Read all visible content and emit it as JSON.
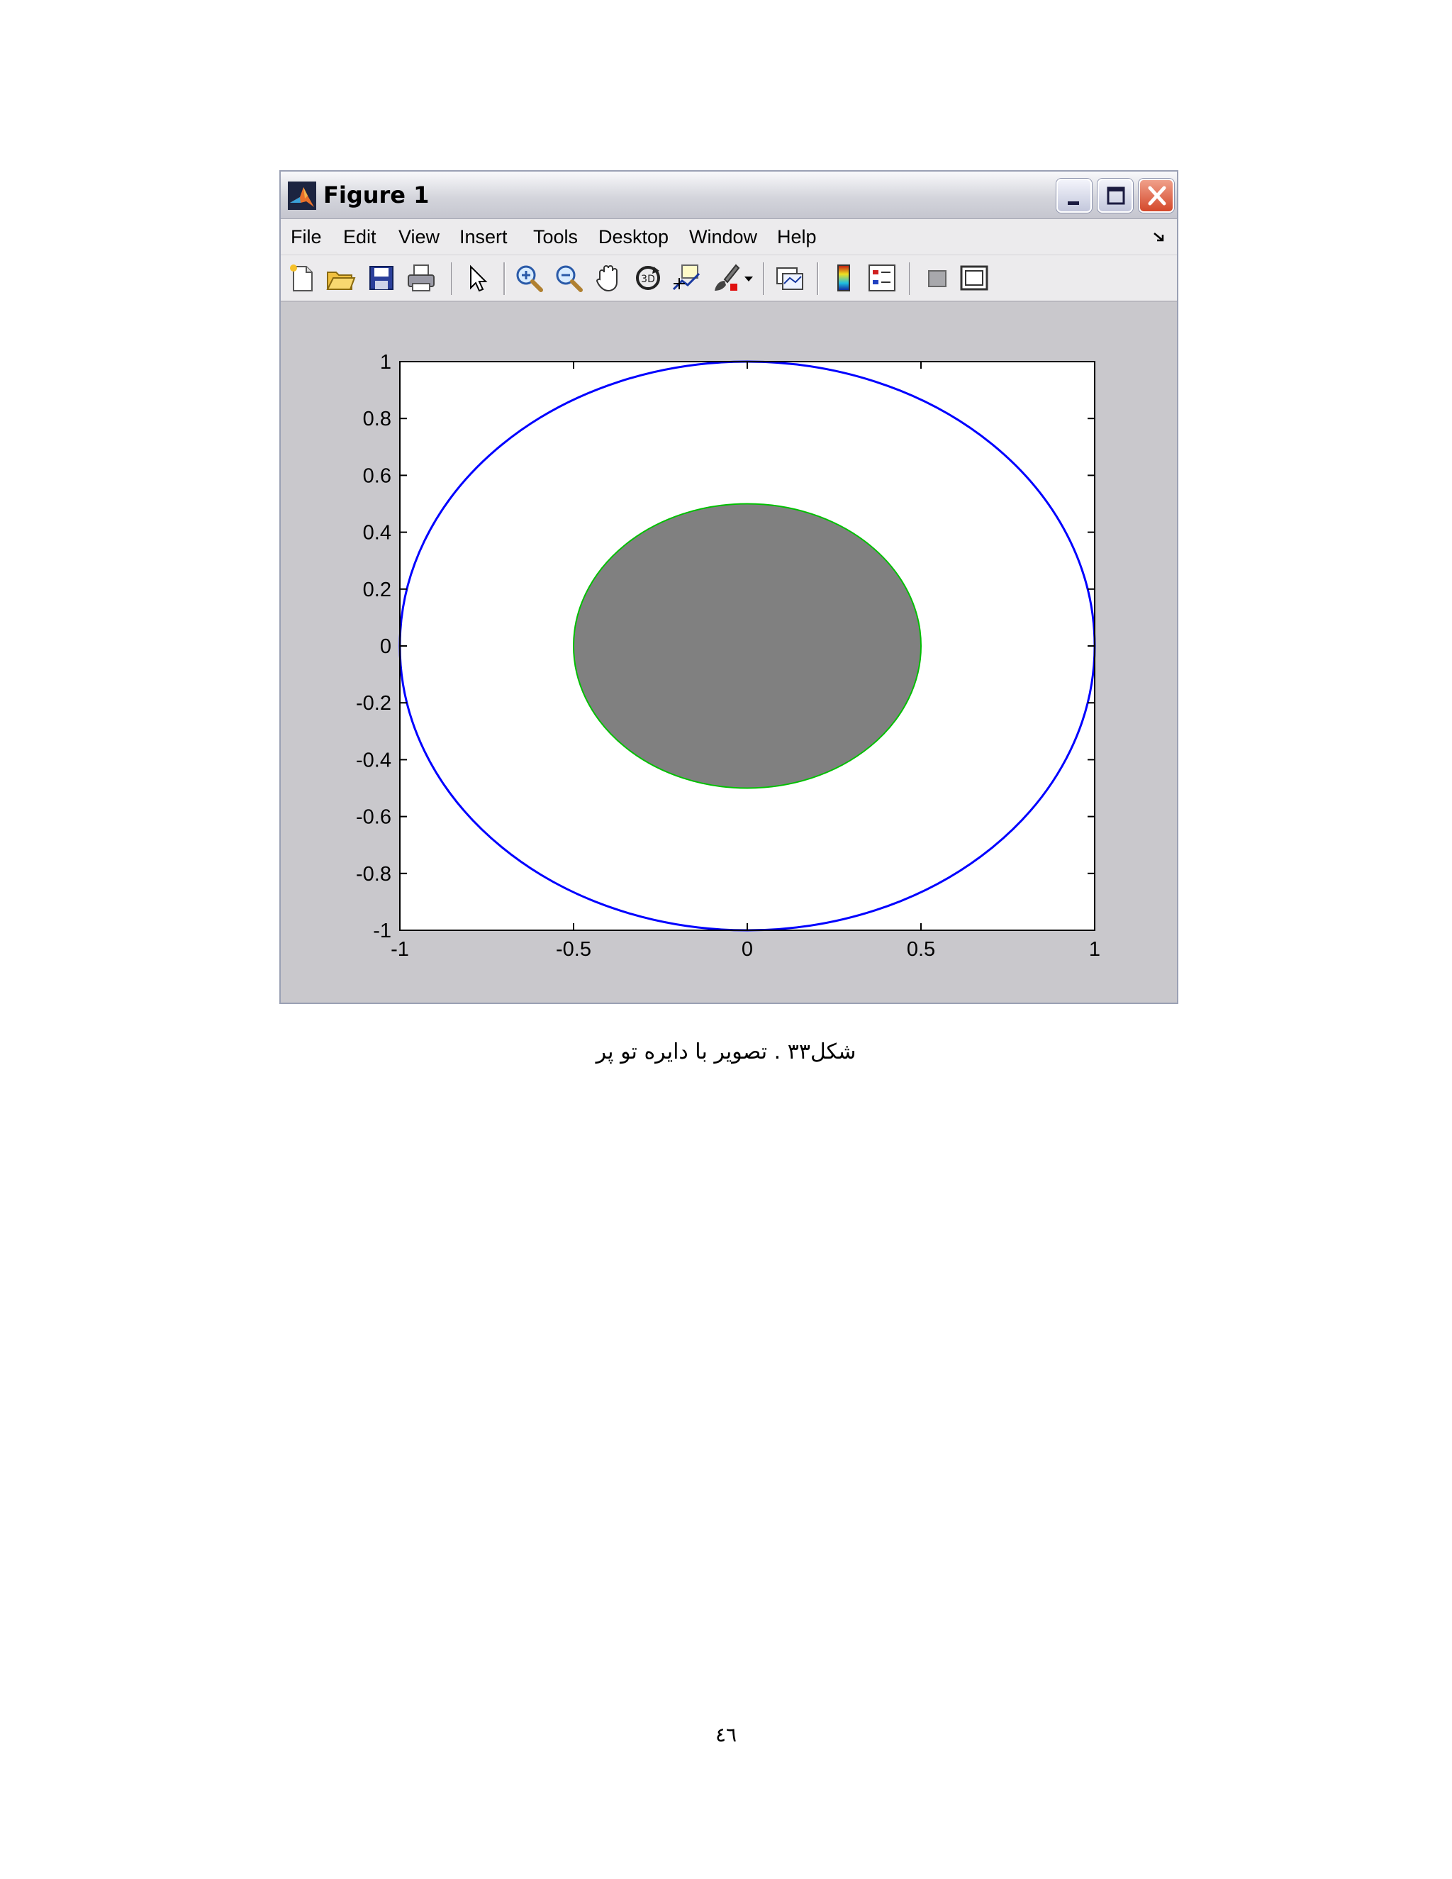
{
  "window": {
    "title": "Figure 1",
    "controls": {
      "minimize": "minimize",
      "maximize": "maximize",
      "close": "close"
    }
  },
  "menubar": {
    "items": [
      "File",
      "Edit",
      "View",
      "Insert",
      "Tools",
      "Desktop",
      "Window",
      "Help"
    ]
  },
  "toolbar": {
    "icons": [
      "new-file-icon",
      "open-folder-icon",
      "save-icon",
      "print-icon",
      "pointer-arrow-icon",
      "zoom-in-icon",
      "zoom-out-icon",
      "pan-hand-icon",
      "rotate-3d-icon",
      "data-cursor-icon",
      "brush-icon",
      "brush-dropdown-icon",
      "link-plot-icon",
      "colorbar-icon",
      "legend-icon",
      "hide-plot-tools-icon",
      "show-plot-tools-icon"
    ]
  },
  "chart_data": {
    "type": "line",
    "xlim": [
      -1,
      1
    ],
    "ylim": [
      -1,
      1
    ],
    "xticks": [
      -1,
      -0.5,
      0,
      0.5,
      1
    ],
    "yticks": [
      -1,
      -0.8,
      -0.6,
      -0.4,
      -0.2,
      0,
      0.2,
      0.4,
      0.6,
      0.8,
      1
    ],
    "xtick_labels": [
      "-1",
      "-0.5",
      "0",
      "0.5",
      "1"
    ],
    "ytick_labels": [
      "-1",
      "-0.8",
      "-0.6",
      "-0.4",
      "-0.2",
      "0",
      "0.2",
      "0.4",
      "0.6",
      "0.8",
      "1"
    ],
    "grid": false,
    "shapes": [
      {
        "kind": "circle",
        "center": [
          0,
          0
        ],
        "radius": 1,
        "stroke": "#0000ff",
        "fill": "none"
      },
      {
        "kind": "circle",
        "center": [
          0,
          0
        ],
        "radius": 0.5,
        "stroke": "#00c000",
        "fill": "#808080"
      }
    ]
  },
  "caption": "شکل۳۳ . تصویر با دایره تو پر",
  "page_number": "٤٦"
}
